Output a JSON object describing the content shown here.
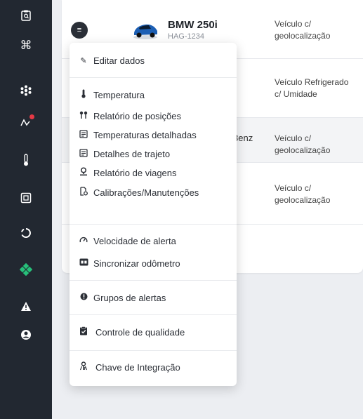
{
  "sidebar": {
    "icons": [
      {
        "name": "clipboard-search-icon",
        "glyph": "📋"
      },
      {
        "name": "command-icon",
        "glyph": "⌘"
      },
      {
        "name": "network-icon",
        "glyph": "❋"
      },
      {
        "name": "route-alert-icon",
        "glyph": "⤲"
      },
      {
        "name": "thermometer-icon",
        "glyph": "🌡"
      },
      {
        "name": "dashboard-panel-icon",
        "glyph": "▣"
      },
      {
        "name": "loading-circle-icon",
        "glyph": "◌"
      },
      {
        "name": "diamond-cluster-icon",
        "glyph": "❖"
      },
      {
        "name": "warning-icon",
        "glyph": "▲"
      },
      {
        "name": "user-icon",
        "glyph": "☻"
      }
    ],
    "accent_green": "#27c07a",
    "alert_red": "#e53945"
  },
  "vehicle": {
    "name": "BMW 250i",
    "plate": "HAG-1234"
  },
  "rows": [
    {
      "type": "Veículo c/\ngeolocalização"
    },
    {
      "type": "Veículo Refrigerado\nc/ Umidade"
    },
    {
      "name_fragment": "3enz",
      "type": "Veículo c/\ngeolocalização"
    },
    {
      "type": "Veículo c/\ngeolocalização"
    }
  ],
  "menu": {
    "items": [
      {
        "label": "Editar dados",
        "icon": "edit-icon",
        "glyph": "✎"
      },
      {
        "label": "Temperatura",
        "icon": "thermometer-icon",
        "glyph": "🌡"
      },
      {
        "label": "Relatório de posições",
        "icon": "positions-icon",
        "glyph": "⁑"
      },
      {
        "label": "Temperaturas detalhadas",
        "icon": "detailed-report-icon",
        "glyph": "▤"
      },
      {
        "label": "Detalhes de trajeto",
        "icon": "route-details-icon",
        "glyph": "▤"
      },
      {
        "label": "Relatório de viagens",
        "icon": "trip-pin-icon",
        "glyph": "⚲"
      },
      {
        "label": "Calibrações/Manutenções",
        "icon": "maintenance-icon",
        "glyph": "⚙"
      },
      {
        "label": "Velocidade de alerta",
        "icon": "speedometer-icon",
        "glyph": "◔"
      },
      {
        "label": "Sincronizar odômetro",
        "icon": "odometer-icon",
        "glyph": "▣"
      },
      {
        "label": "Grupos de alertas",
        "icon": "alert-group-icon",
        "glyph": "●"
      },
      {
        "label": "Controle de qualidade",
        "icon": "quality-control-icon",
        "glyph": "▦"
      },
      {
        "label": "Chave de Integração",
        "icon": "integration-key-icon",
        "glyph": "⚿"
      }
    ]
  }
}
